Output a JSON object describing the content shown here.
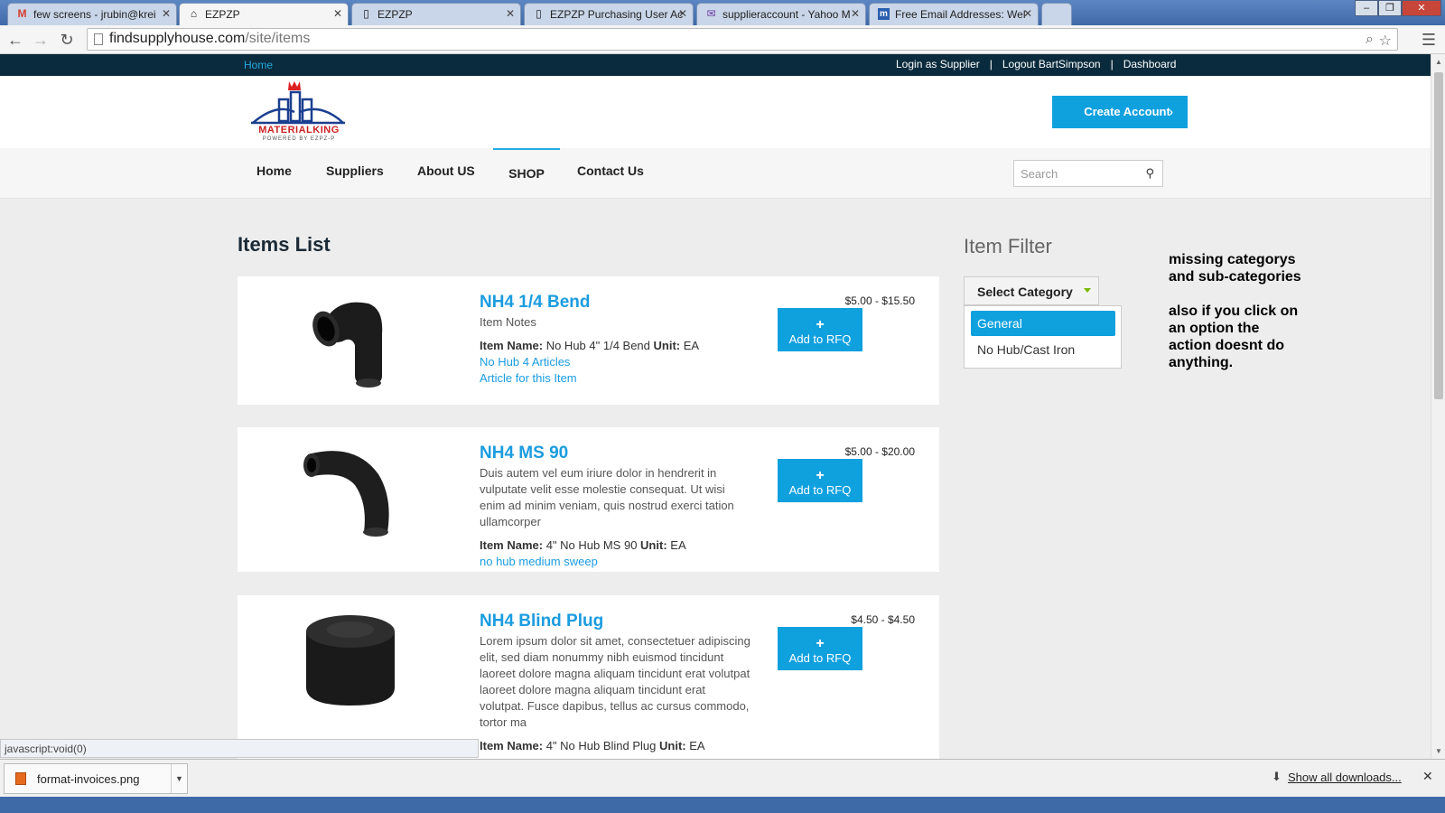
{
  "browser": {
    "tabs": [
      {
        "label": "few screens - jrubin@krei",
        "icon": "gmail-icon"
      },
      {
        "label": "EZPZP",
        "icon": "home-icon"
      },
      {
        "label": "EZPZP",
        "icon": "page-icon"
      },
      {
        "label": "EZPZP Purchasing User Ac",
        "icon": "page-icon"
      },
      {
        "label": "supplieraccount - Yahoo M",
        "icon": "yahoo-mail-icon"
      },
      {
        "label": "Free Email Addresses: Wel",
        "icon": "m-icon"
      }
    ],
    "url_domain": "findsupplyhouse.com",
    "url_path": "/site/items"
  },
  "site": {
    "top_home": "Home",
    "top_links": [
      "Login as Supplier",
      "Logout BartSimpson",
      "Dashboard"
    ],
    "create_account": "Create Account",
    "logo_text": "MATERIALKING",
    "logo_sub": "POWERED BY EZPZ-P",
    "nav": [
      "Home",
      "Suppliers",
      "About US",
      "SHOP",
      "Contact Us"
    ],
    "search_placeholder": "Search"
  },
  "items_list": {
    "title": "Items List",
    "items": [
      {
        "title": "NH4 1/4 Bend",
        "description": "Item Notes",
        "item_name_label": "Item Name:",
        "item_name": "No Hub 4\" 1/4 Bend",
        "unit_label": "Unit:",
        "unit": "EA",
        "links": [
          "No Hub 4 Articles",
          "Article for this Item"
        ],
        "price": "$5.00 - $15.50",
        "rfq_plus": "+",
        "rfq_label": "Add to RFQ"
      },
      {
        "title": "NH4 MS 90",
        "description": "Duis autem vel eum iriure dolor in hendrerit in vulputate velit esse molestie consequat. Ut wisi enim ad minim veniam, quis nostrud exerci tation ullamcorper",
        "item_name_label": "Item Name:",
        "item_name": "4\" No Hub MS 90",
        "unit_label": "Unit:",
        "unit": "EA",
        "links": [
          "no hub medium sweep"
        ],
        "price": "$5.00 - $20.00",
        "rfq_plus": "+",
        "rfq_label": "Add to RFQ"
      },
      {
        "title": "NH4 Blind Plug",
        "description": "Lorem ipsum dolor sit amet, consectetuer adipiscing elit, sed diam nonummy nibh euismod tincidunt laoreet dolore magna aliquam tincidunt erat volutpat laoreet dolore magna aliquam tincidunt erat volutpat. Fusce dapibus, tellus ac cursus commodo, tortor ma",
        "item_name_label": "Item Name:",
        "item_name": "4\" No Hub Blind Plug",
        "unit_label": "Unit:",
        "unit": "EA",
        "links": [],
        "price": "$4.50 - $4.50",
        "rfq_plus": "+",
        "rfq_label": "Add to RFQ"
      }
    ]
  },
  "filter": {
    "title": "Item Filter",
    "select_label": "Select Category",
    "options": [
      "General",
      "No Hub/Cast Iron"
    ],
    "selected": "General"
  },
  "annotation": {
    "line1": "missing categorys and sub-categories",
    "line2": "also if you click on an option the action doesnt do anything."
  },
  "status_bar": "javascript:void(0)",
  "downloads": {
    "file": "format-invoices.png",
    "show_all": "Show all downloads..."
  },
  "colors": {
    "accent": "#0fa0de",
    "topbar": "#0a2b3d",
    "link": "#1a9ce0"
  }
}
